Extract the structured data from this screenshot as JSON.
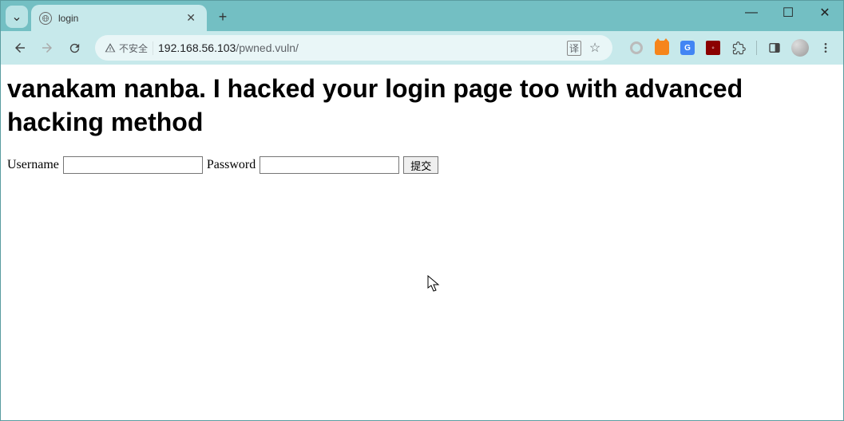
{
  "window": {
    "tab_title": "login",
    "dropdown_glyph": "⌄",
    "new_tab_glyph": "+",
    "close_glyph": "✕",
    "min_glyph": "—",
    "max_glyph": "☐"
  },
  "toolbar": {
    "security_label": "不安全",
    "url_host": "192.168.56.103",
    "url_path": "/pwned.vuln/",
    "translate_label": "译",
    "star_glyph": "☆"
  },
  "page": {
    "heading": "vanakam nanba. I hacked your login page too with advanced hacking method",
    "username_label": "Username",
    "password_label": "Password",
    "submit_label": "提交"
  }
}
